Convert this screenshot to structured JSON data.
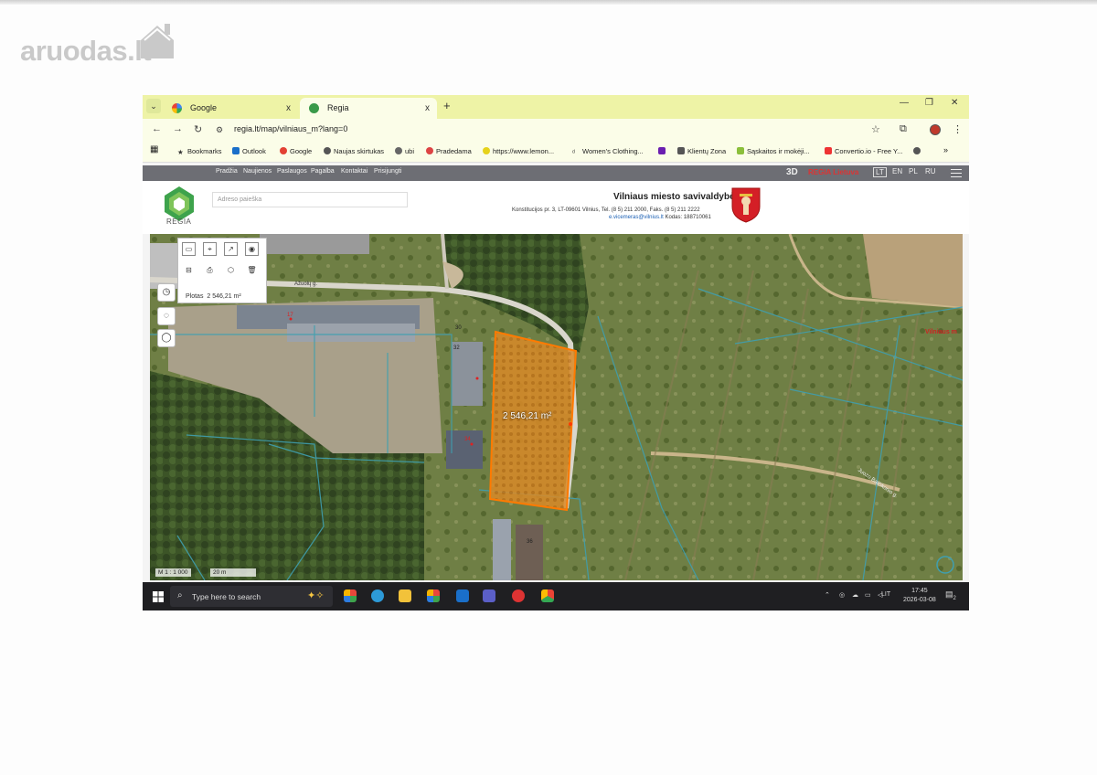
{
  "watermark": {
    "brand": "aruodas",
    "tld": ".lt"
  },
  "browser": {
    "tabs": [
      {
        "label": "Google",
        "active": false
      },
      {
        "label": "Regia",
        "active": true
      }
    ],
    "tab_close": "x",
    "new_tab": "+",
    "url": "regia.lt/map/vilniaus_m?lang=0",
    "bookmarks": [
      "Bookmarks",
      "Outlook",
      "Google",
      "Naujas skirtukas",
      "ubi",
      "Pradedama",
      "https://www.lemon...",
      "Women's Clothing...",
      "",
      "Klientų Zona",
      "Sąskaitos ir mokėji...",
      "Convertio.io - Free Y...",
      "",
      "»"
    ]
  },
  "regia": {
    "nav_links": [
      "Pradžia",
      "Naujienos",
      "Paslaugos",
      "Pagalba",
      "Kontaktai",
      "Prisijungti"
    ],
    "mode_3d": "3D",
    "region": "REGIA Lietuva",
    "languages": [
      "LT",
      "EN",
      "PL",
      "RU"
    ],
    "logo_text": "REGIA",
    "search_placeholder": "Adreso paieška",
    "municipality": "Vilniaus miesto savivaldybė",
    "address_line": "Konstitucijos pr. 3, LT-09601 Vilnius, Tel. (8 5) 211 2000, Faks. (8 5) 211 2222",
    "email": "e.vicemeras@vilnius.lt",
    "code_line": "Kodas: 188710061"
  },
  "map": {
    "tool_area_label": "Plotas",
    "tool_area_value": "2 546,21 m²",
    "selected_area_label": "2 546,21 m²",
    "street_label_1": "Ažuolų g.",
    "street_label_2": "Juozo Balčikonio g.",
    "district_label": "Vilniaus m",
    "parcel_numbers": [
      "17",
      "30",
      "32",
      "34",
      "36"
    ],
    "scale_text": "M 1 : 1 000",
    "scale_bar": "20 m"
  },
  "taskbar": {
    "search_placeholder": "Type here to search",
    "language": "LIT",
    "time": "17:45",
    "date": "2026-03-08",
    "notif_count": "2"
  }
}
